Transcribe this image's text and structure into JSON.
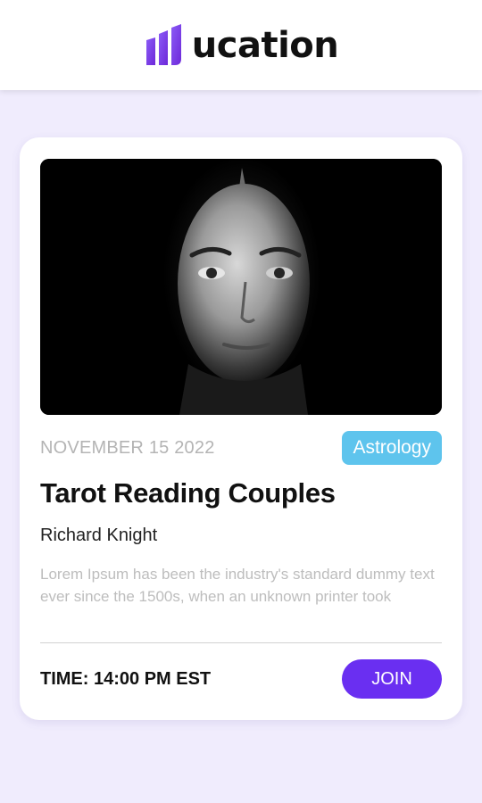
{
  "brand": {
    "name": "Ucation",
    "logo_text": "ucation",
    "logo_icon": "bar-stack-logo-icon",
    "accent_color": "#6a2ff1",
    "icon_color": "#7c3aed"
  },
  "event": {
    "image_icon": "portrait-photo",
    "date": "NOVEMBER 15 2022",
    "tag": "Astrology",
    "tag_color": "#5ec4ed",
    "title": "Tarot Reading Couples",
    "author": "Richard Knight",
    "description": "Lorem Ipsum has been the industry's standard dummy text ever since the 1500s, when an unknown printer took",
    "time": "TIME: 14:00 PM EST",
    "join_label": "JOIN"
  }
}
